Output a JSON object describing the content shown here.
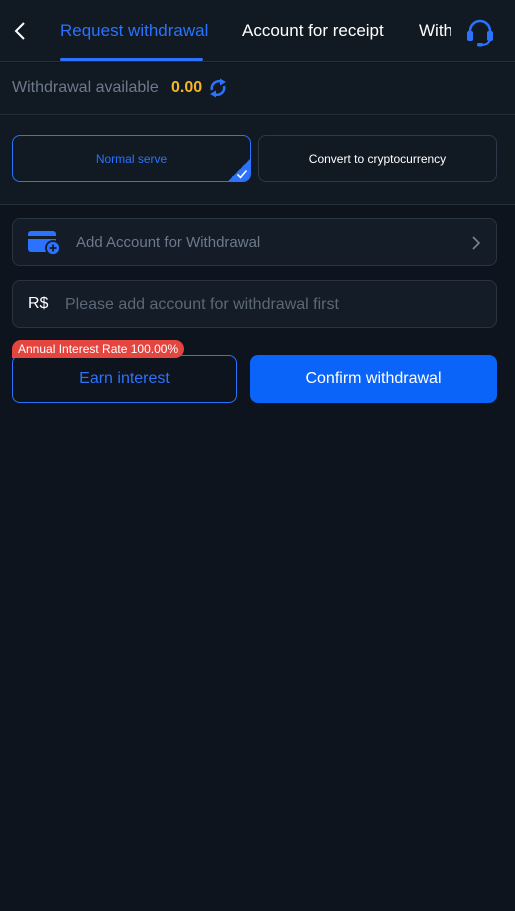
{
  "header": {
    "tabs": [
      {
        "label": "Request withdrawal",
        "active": true
      },
      {
        "label": "Account for receipt",
        "active": false
      },
      {
        "label": "Withdrawal",
        "active": false
      }
    ],
    "back_icon": "chevron-left-icon",
    "support_icon": "headset-icon"
  },
  "balance": {
    "label": "Withdrawal available",
    "value": "0.00",
    "refresh_icon": "refresh-icon"
  },
  "modes": [
    {
      "label": "Normal serve",
      "selected": true
    },
    {
      "label": "Convert to cryptocurrency",
      "selected": false
    }
  ],
  "account": {
    "label": "Add Account for Withdrawal",
    "icon": "wallet-add-icon"
  },
  "amount": {
    "currency": "R$",
    "placeholder": "Please add account for withdrawal first"
  },
  "actions": {
    "interest_badge": "Annual Interest Rate 100.00%",
    "earn_label": "Earn interest",
    "confirm_label": "Confirm withdrawal"
  },
  "colors": {
    "accent": "#2b72ff",
    "background": "#0e141d",
    "balance": "#f4b526",
    "badge": "#e5453f"
  }
}
